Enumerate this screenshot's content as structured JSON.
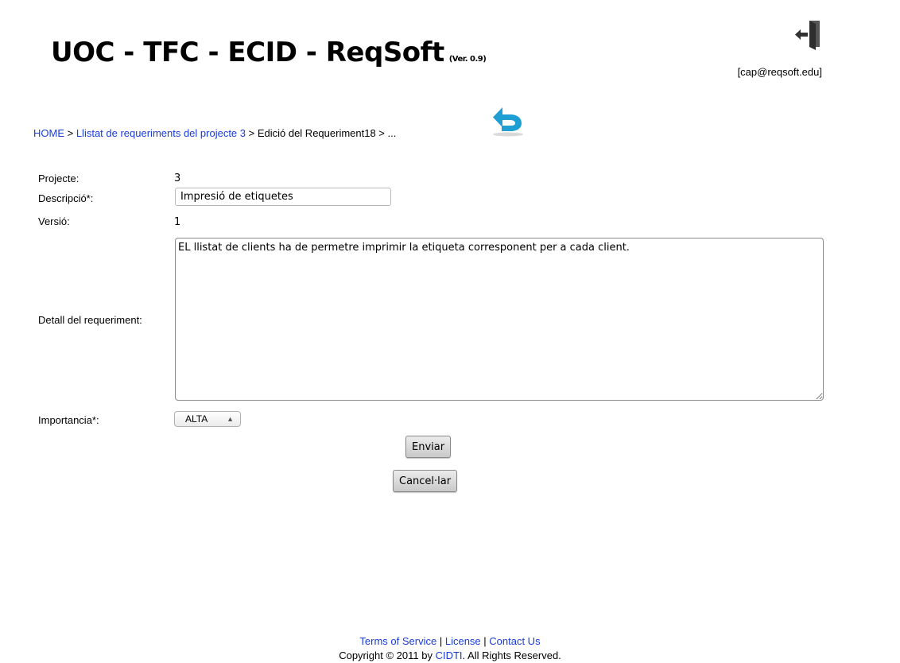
{
  "header": {
    "title": "UOC - TFC - ECID - ReqSoft",
    "version": "(Ver. 0.9)",
    "user": "[cap@reqsoft.edu]"
  },
  "breadcrumb": {
    "home": "HOME",
    "sep1": " > ",
    "list": "Llistat de requeriments del projecte 3",
    "rest": " > Edició del Requeriment18 > ..."
  },
  "form": {
    "project_label": "Projecte:",
    "project_value": "3",
    "description_label": "Descripció*:",
    "description_value": "Impresió de etiquetes",
    "version_label": "Versió:",
    "version_value": "1",
    "detail_label": "Detall del requeriment:",
    "detail_value": "EL llistat de clients ha de permetre imprimir la etiqueta corresponent per a cada client.",
    "importance_label": "Importancia*:",
    "importance_value": "ALTA",
    "submit_label": "Enviar",
    "cancel_label": "Cancel·lar"
  },
  "footer": {
    "terms": "Terms of Service",
    "license": "License",
    "contact": "Contact Us",
    "sep": " | ",
    "copyright_prefix": "Copyright © 2011 by ",
    "copyright_link": "CIDTI",
    "copyright_suffix": ". All Rights Reserved."
  },
  "colors": {
    "link": "#1a3cd6",
    "back_icon": "#1e9ed3"
  }
}
